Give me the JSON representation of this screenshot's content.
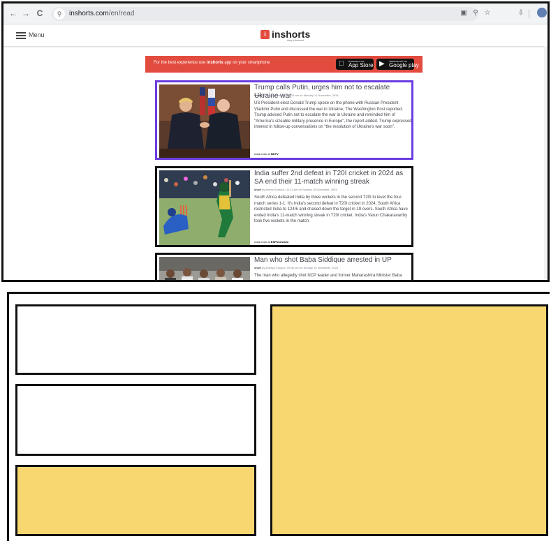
{
  "browser": {
    "url_host": "inshorts.com",
    "url_path": "/en/read",
    "nav_back": "←",
    "nav_forward": "→",
    "nav_reload": "C",
    "site_info_glyph": "⚲",
    "tool_glyphs": [
      "▣",
      "⚲",
      "☆",
      "⇩",
      "⋮"
    ]
  },
  "site": {
    "menu_label": "Menu",
    "logo_mark": "i",
    "logo_text": "inshorts",
    "logo_sub": "stay informed"
  },
  "banner": {
    "text_before": "For the best experience use ",
    "text_brand": "inshorts",
    "text_after": " app on your smartphone",
    "appstore_small": "Download on the",
    "appstore_big": "App Store",
    "googleplay_small": "ANDROID APP ON",
    "googleplay_big": "Google play"
  },
  "news": [
    {
      "title": "Trump calls Putin, urges him not to escalate Ukraine war",
      "meta_short": "short",
      "meta_rest": " by Pragya Swastik / 08:29 am on Monday 11 November, 2024",
      "body": "US President-elect Donald Trump spoke on the phone with Russian President Vladimir Putin and discussed the war in Ukraine, The Washington Post reported. Trump advised Putin not to escalate the war in Ukraine and reminded him of \"America's sizeable military presence in Europe\", the report added. Trump expressed interest in follow-up conversations on \"the resolution of Ukraine's war soon\".",
      "more_prefix": "read more at ",
      "more_source": "NDTV"
    },
    {
      "title": "India suffer 2nd defeat in T20I cricket in 2024 as SA end their 11-match winning streak",
      "meta_short": "short",
      "meta_rest": " by Anmol Sharma / 11:15 pm on Sunday 10 November, 2024",
      "body": "South Africa defeated India by three wickets in the second T20I to level the four-match series 1-1. It's India's second defeat in T20I cricket in 2024. South Africa restricted India to 124/6 and chased down the target in 19 overs. South Africa have ended India's 11-match winning streak in T20I cricket. India's Varun Chakaravarthy took five wickets in the match.",
      "more_prefix": "read more at ",
      "more_source": "ESPNcricinfo"
    },
    {
      "title": "Man who shot Baba Siddique arrested in UP",
      "meta_short": "short",
      "meta_rest": " by Arshiya Chopra / 09:40 pm on Sunday 10 November, 2024",
      "body": "The man who allegedly shot NCP leader and former Maharashtra Minister Baba Siddique...",
      "more_prefix": "",
      "more_source": ""
    }
  ],
  "colors": {
    "accent_red": "#e24c3f",
    "selection_purple": "#6a3de0",
    "layout_yellow": "#f8d771"
  }
}
